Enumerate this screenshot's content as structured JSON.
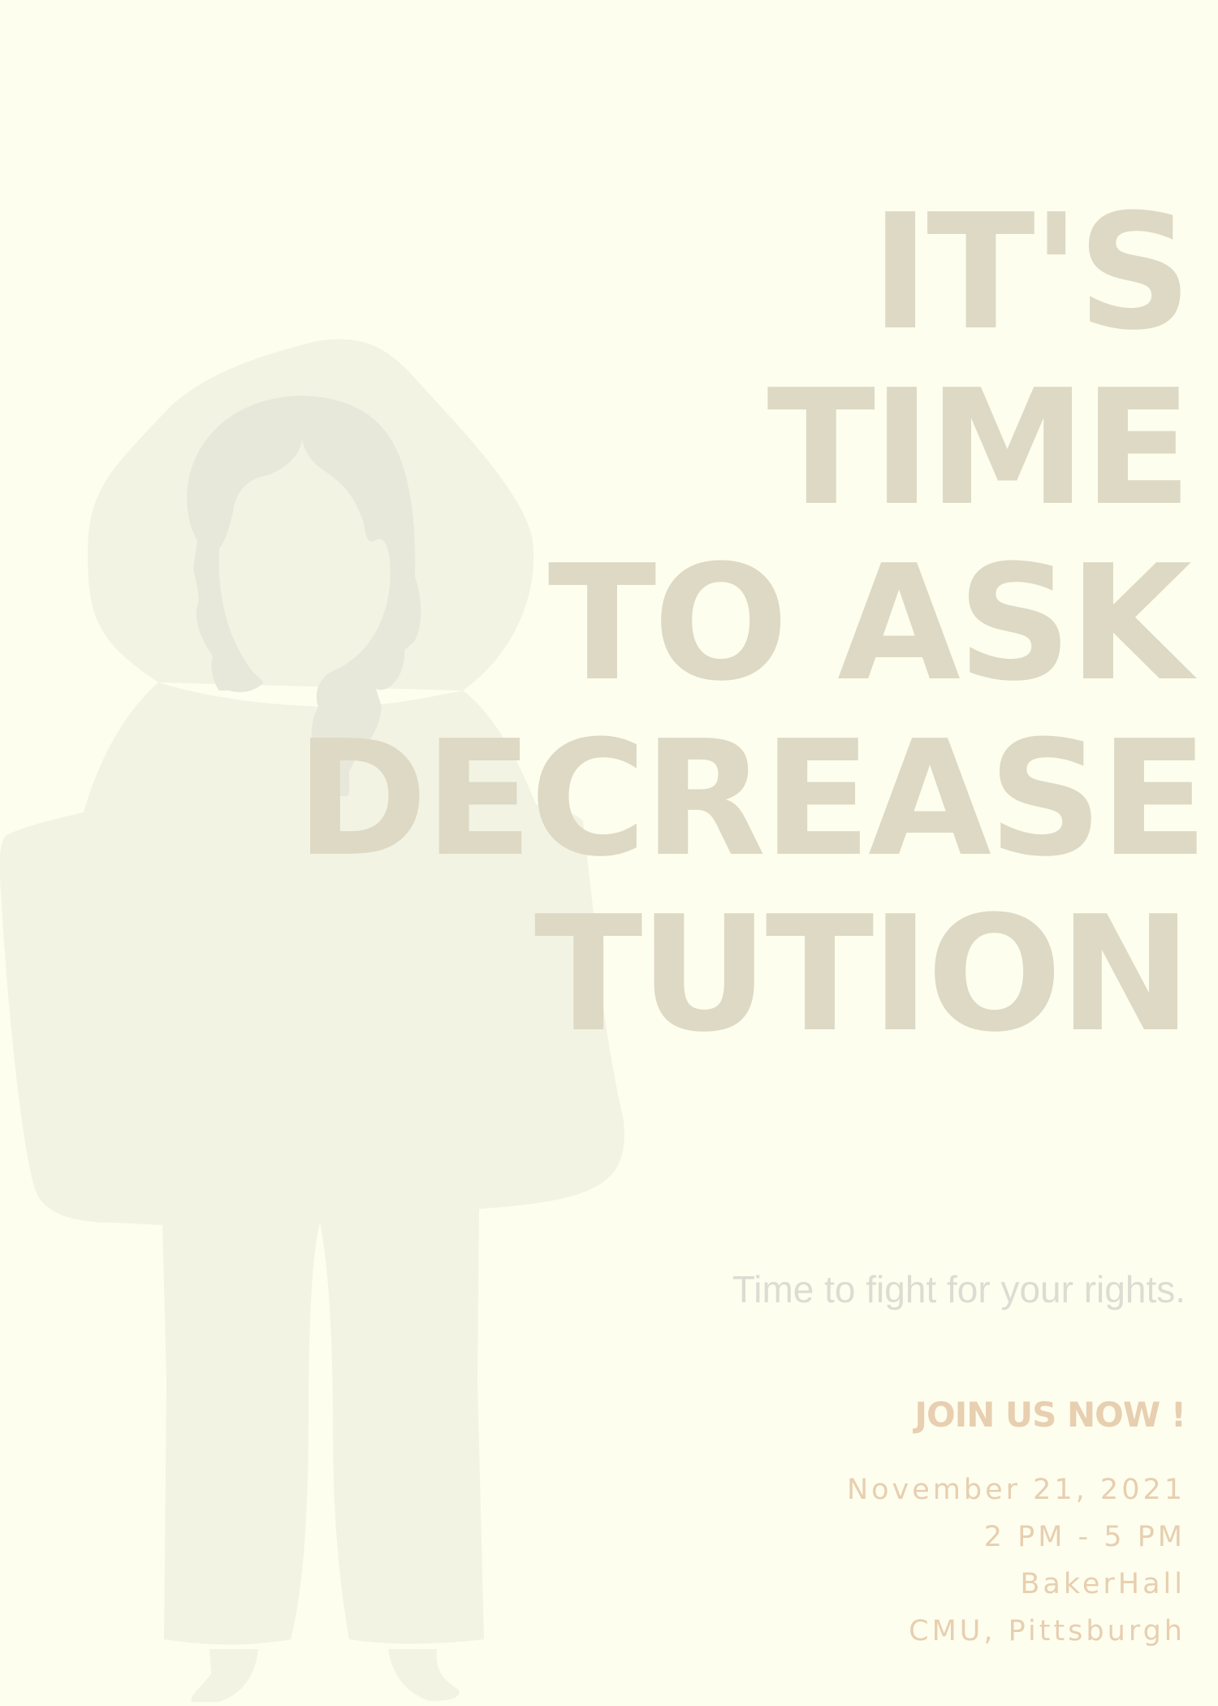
{
  "poster": {
    "headline": {
      "lines": [
        "IT'S",
        "TIME",
        "TO ASK",
        "DECREASE",
        "TUTION"
      ]
    },
    "tagline": "Time to fight for your rights.",
    "cta": "JOIN US NOW !",
    "details": {
      "date": "November 21, 2021",
      "time": "2 PM - 5 PM",
      "venue": "BakerHall",
      "location": "CMU, Pittsburgh"
    }
  },
  "colors": {
    "background": "#fefeef",
    "headline": "#ddd9c4",
    "tagline": "#dcdcd2",
    "accent": "#e7cfb0",
    "figure_body": "#f3f3e4",
    "figure_hair": "#e8e8da"
  },
  "illustration": "hooded-person-silhouette"
}
